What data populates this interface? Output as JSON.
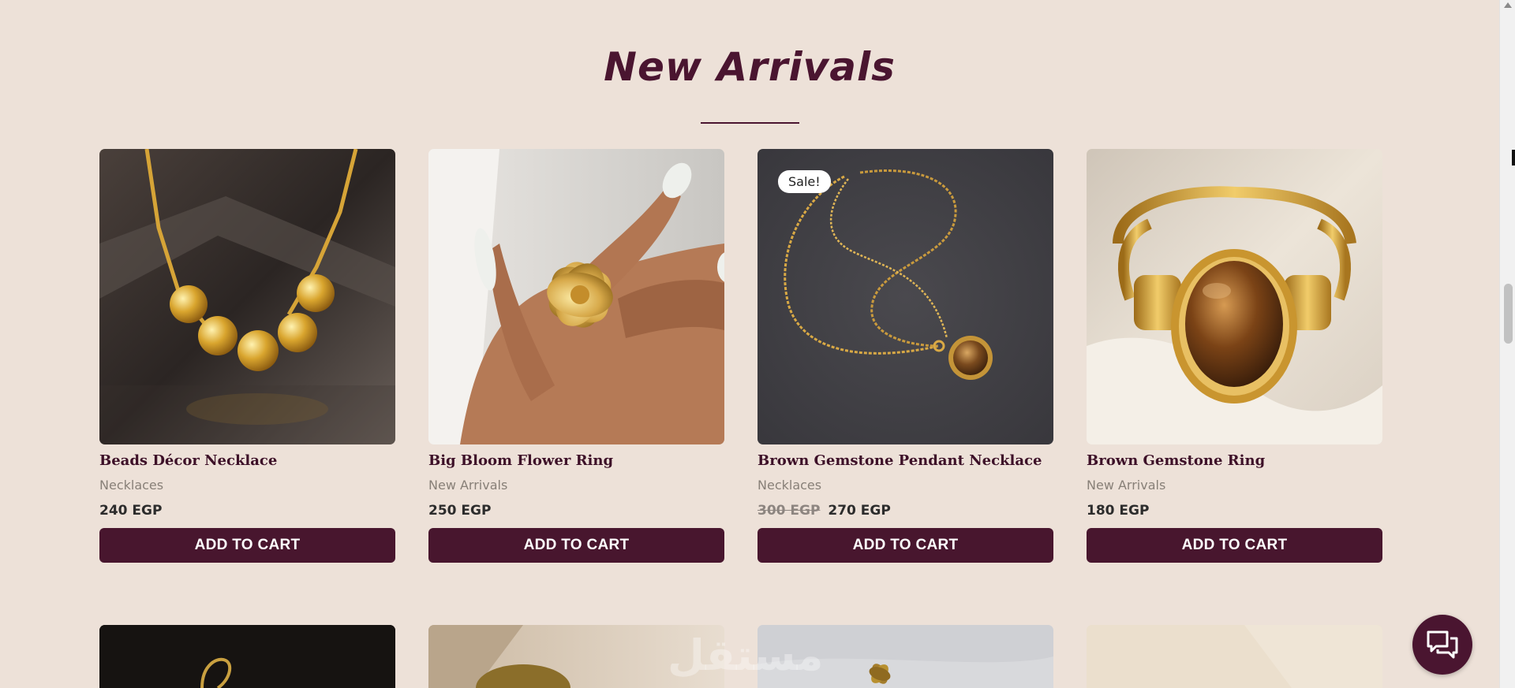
{
  "section": {
    "title": "New Arrivals"
  },
  "products": [
    {
      "name": "Beads Décor Necklace",
      "category": "Necklaces",
      "price": "240 EGP",
      "old_price": "",
      "badge": "",
      "button": "ADD TO CART"
    },
    {
      "name": "Big Bloom Flower Ring",
      "category": "New Arrivals",
      "price": "250 EGP",
      "old_price": "",
      "badge": "",
      "button": "ADD TO CART"
    },
    {
      "name": "Brown Gemstone Pendant Necklace",
      "category": "Necklaces",
      "price": "270 EGP",
      "old_price": "300 EGP",
      "badge": "Sale!",
      "button": "ADD TO CART"
    },
    {
      "name": "Brown Gemstone Ring",
      "category": "New Arrivals",
      "price": "180 EGP",
      "old_price": "",
      "badge": "",
      "button": "ADD TO CART"
    }
  ],
  "watermark": "مستقل",
  "chat": {
    "icon": "chat-bubbles-icon"
  },
  "colors": {
    "background": "#ede1d8",
    "brand": "#48162e",
    "title": "#4a1530"
  }
}
